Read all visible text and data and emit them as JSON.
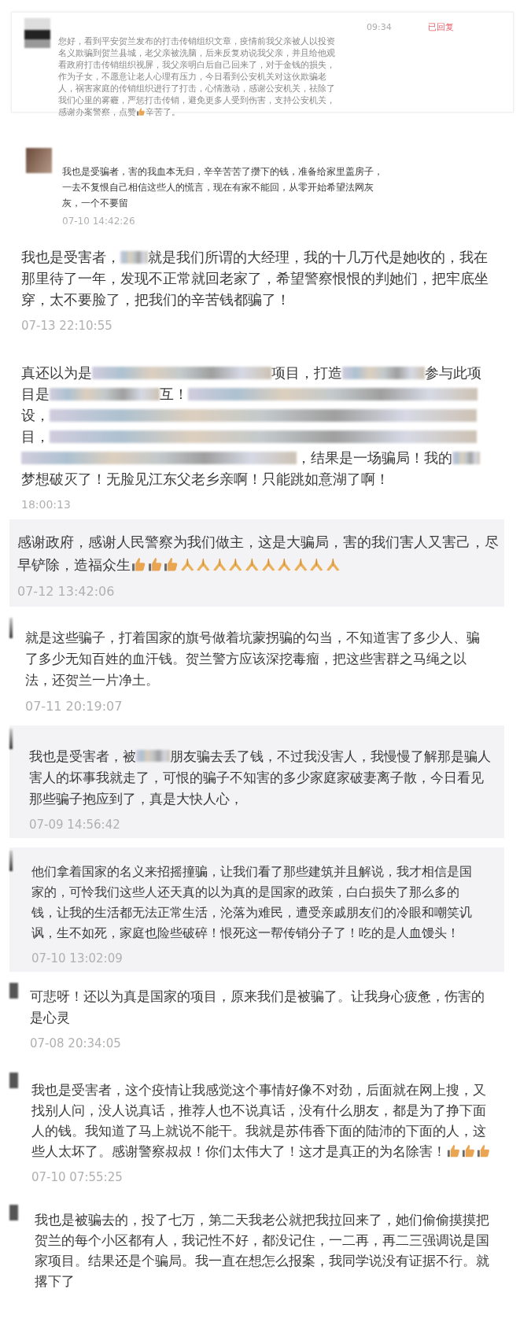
{
  "message": {
    "time": "09:34",
    "status": "已回复",
    "parts": [
      {
        "kind": "text",
        "text": "您好，看到平安贺兰发布的打击传销组织文章，疫情前我父亲被人以投资名义欺骗到贺兰县城，老父亲被洗脑，后来反复劝说我父亲，并且给他观看政府打击传销组织视屏，我父亲明白后自己回来了，对于金钱的损失，作为子女，不愿意让老人心理有压力，今日看到公安机关对这伙欺骗老人，祸害家庭的传销组织进行了打击，心情激动，感谢公安机关，祛除了我们心里的雾霾，严惩打击传销，避免更多人受到伤害，支持公安机关，感谢办案警察，点赞"
      },
      {
        "kind": "thumb"
      },
      {
        "kind": "text",
        "text": "辛苦了。"
      }
    ]
  },
  "comments": [
    {
      "kind": "plain",
      "time": "07-10 14:42:26",
      "parts": [
        {
          "kind": "text",
          "text": "我也是受骗者，害的我血本无归，辛辛苦苦了攒下的钱，准备给家里盖房子，一去不复恨自己相信这些人的慌言，现在有家不能回，从零开始希望法网灰灰，一个不要留"
        }
      ]
    },
    {
      "kind": "plain",
      "time": "07-13 22:10:55",
      "parts": [
        {
          "kind": "text",
          "text": "我也是受害者，"
        },
        {
          "kind": "blur"
        },
        {
          "kind": "text",
          "text": "就是我们所谓的大经理，我的十几万代是她收的，我在那里待了一年，发现不正常就回老家了，希望警察恨恨的判她们，把牢底坐穿，太不要脸了，把我们的辛苦钱都骗了！"
        }
      ]
    },
    {
      "kind": "plain",
      "time": "18:00:13",
      "parts": [
        {
          "kind": "text",
          "text": "真还以为是"
        },
        {
          "kind": "blur"
        },
        {
          "kind": "text",
          "text": "项目，打造"
        },
        {
          "kind": "blur"
        },
        {
          "kind": "text",
          "text": "参与此项目是"
        },
        {
          "kind": "blur"
        },
        {
          "kind": "text",
          "text": "互！"
        },
        {
          "kind": "blur"
        },
        {
          "kind": "text",
          "text": "设，"
        },
        {
          "kind": "blur"
        },
        {
          "kind": "text",
          "text": "目，"
        },
        {
          "kind": "blur"
        },
        {
          "kind": "blur"
        },
        {
          "kind": "text",
          "text": "，结果是一场骗局！我的"
        },
        {
          "kind": "blur"
        },
        {
          "kind": "text",
          "text": "梦想破灭了！无脸见江东父老乡亲啊！只能跳如意湖了啊！"
        }
      ]
    },
    {
      "kind": "card",
      "time": "07-12 13:42:06",
      "parts": [
        {
          "kind": "text",
          "text": "感谢政府，感谢人民警察为我们做主，这是大骗局，害的我们害人又害己，尽早铲除，造福众生"
        },
        {
          "kind": "thumb"
        },
        {
          "kind": "thumb"
        },
        {
          "kind": "thumb"
        },
        {
          "kind": "pray"
        },
        {
          "kind": "pray"
        },
        {
          "kind": "pray"
        },
        {
          "kind": "pray"
        },
        {
          "kind": "pray"
        },
        {
          "kind": "pray"
        },
        {
          "kind": "pray"
        },
        {
          "kind": "pray"
        },
        {
          "kind": "pray"
        },
        {
          "kind": "pray"
        }
      ]
    },
    {
      "kind": "plain",
      "time": "07-11 20:19:07",
      "parts": [
        {
          "kind": "text",
          "text": "就是这些骗子，打着国家的旗号做着坑蒙拐骗的勾当，不知道害了多少人、骗了多少无知百姓的血汗钱。贺兰警方应该深挖毒瘤，把这些害群之马绳之以法，还贺兰一片净土。"
        }
      ]
    },
    {
      "kind": "card",
      "time": "07-09 14:56:42",
      "parts": [
        {
          "kind": "text",
          "text": "我也是受害者，被"
        },
        {
          "kind": "blur"
        },
        {
          "kind": "text",
          "text": "朋友骗去丢了钱，不过我没害人，我慢慢了解那是骗人害人的坏事我就走了，可恨的骗子不知害的多少家庭家破妻离子散，今日看见那些骗子抱应到了，真是大快人心，"
        }
      ]
    },
    {
      "kind": "card",
      "time": "07-10 13:02:09",
      "parts": [
        {
          "kind": "text",
          "text": "他们拿着国家的名义来招摇撞骗，让我们看了那些建筑并且解说，我才相信是国家的，可怜我们这些人还天真的以为真的是国家的政策，白白损失了那么多的钱，让我的生活都无法正常生活，沦落为难民，遭受亲戚朋友们的冷眼和嘲笑讥讽，生不如死，家庭也险些破碎！恨死这一帮传销分子了！吃的是人血馒头！"
        }
      ]
    },
    {
      "kind": "plain",
      "time": "07-08 20:34:05",
      "parts": [
        {
          "kind": "text",
          "text": "可悲呀！还以为真是国家的项目，原来我们是被骗了。让我身心疲惫，伤害的是心灵"
        }
      ]
    },
    {
      "kind": "plain",
      "time": "07-10 07:55:25",
      "parts": [
        {
          "kind": "text",
          "text": "我也是受害者，这个疫情让我感觉这个事情好像不对劲，后面就在网上搜，又找别人问，没人说真话，推荐人也不说真话，没有什么朋友，都是为了挣下面人的钱。我知道了马上就说不能干。我就是苏伟香下面的陆沛的下面的人，这些人太坏了。感谢警察叔叔！你们太伟大了！这才是真正的为名除害！"
        },
        {
          "kind": "thumb"
        },
        {
          "kind": "thumb"
        },
        {
          "kind": "thumb"
        }
      ]
    },
    {
      "kind": "plain",
      "parts": [
        {
          "kind": "text",
          "text": "我也是被骗去的，投了七万，第二天我老公就把我拉回来了，她们偷偷摸摸把贺兰的每个小区都有人，我记性不好，都没记住，一二再，再二三强调说是国家项目。结果还是个骗局。我一直在想怎么报案，我同学说没有证据不行。就撂下了"
        }
      ]
    }
  ]
}
